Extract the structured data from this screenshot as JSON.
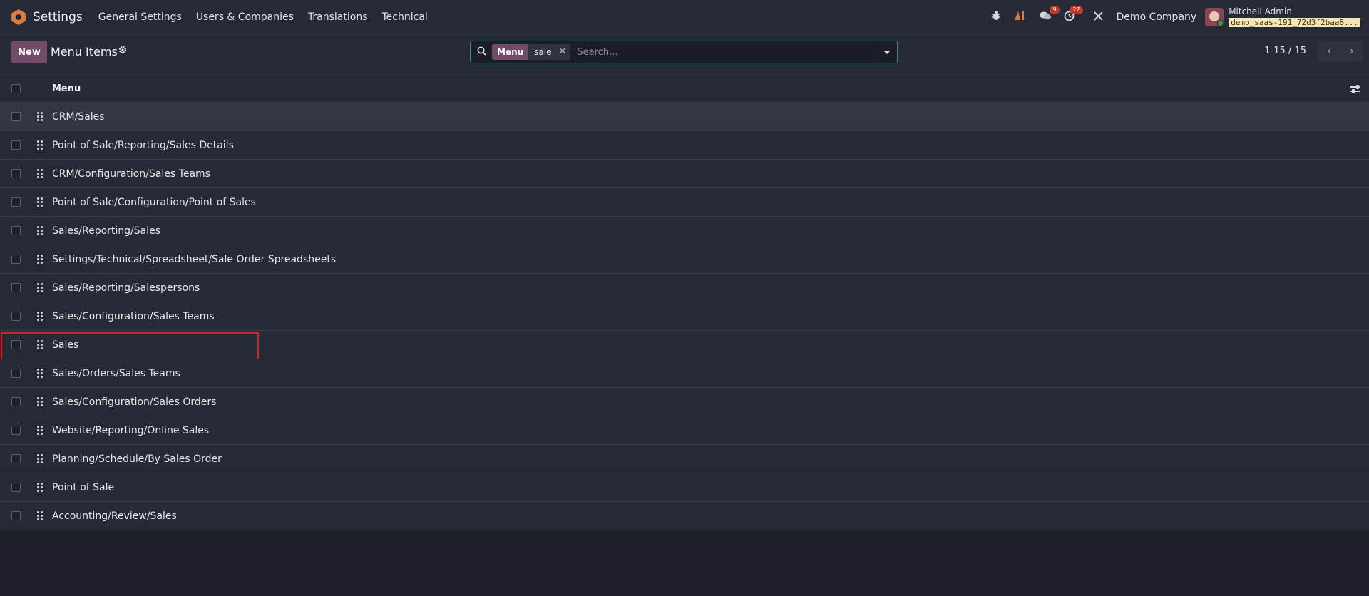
{
  "navbar": {
    "app_name": "Settings",
    "menu": [
      "General Settings",
      "Users & Companies",
      "Translations",
      "Technical"
    ],
    "messages_badge": "9",
    "activities_badge": "27",
    "company": "Demo Company",
    "user_name": "Mitchell Admin",
    "db_name": "demo_saas-191_72d3f2baa8..."
  },
  "control": {
    "new_label": "New",
    "title": "Menu Items",
    "search": {
      "facet_label": "Menu",
      "facet_value": "sale",
      "placeholder": "Search..."
    },
    "pager": "1-15 / 15"
  },
  "list": {
    "column": "Menu",
    "rows": [
      "CRM/Sales",
      "Point of Sale/Reporting/Sales Details",
      "CRM/Configuration/Sales Teams",
      "Point of Sale/Configuration/Point of Sales",
      "Sales/Reporting/Sales",
      "Settings/Technical/Spreadsheet/Sale Order Spreadsheets",
      "Sales/Reporting/Salespersons",
      "Sales/Configuration/Sales Teams",
      "Sales",
      "Sales/Orders/Sales Teams",
      "Sales/Configuration/Sales Orders",
      "Website/Reporting/Online Sales",
      "Planning/Schedule/By Sales Order",
      "Point of Sale",
      "Accounting/Review/Sales"
    ]
  },
  "colors": {
    "accent": "#714b67",
    "highlight": "#e51b24",
    "search_border": "#2f8b8a"
  }
}
